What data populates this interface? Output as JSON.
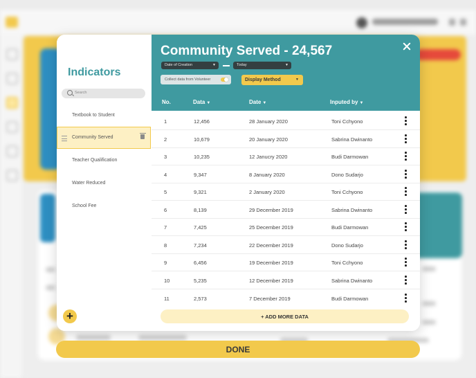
{
  "background": {
    "greeting": "Welcome, John Samuel"
  },
  "modal": {
    "title": "Community Served - 24,567",
    "indicators_title": "Indicators",
    "search_placeholder": "Search",
    "indicators": [
      "Textbook to Student",
      "Community Served",
      "Teacher Qualification",
      "Water Reduced",
      "School Fee"
    ],
    "active_indicator": "Community Served",
    "date_from": "Date of Creation",
    "date_to": "Today",
    "volunteer_toggle": "Collect data from Volunteer",
    "volunteer_enabled": true,
    "display_method": "Display Method",
    "columns": {
      "no": "No.",
      "data": "Data",
      "date": "Date",
      "inputed_by": "Inputed by"
    },
    "rows": [
      {
        "no": "1",
        "data": "12,456",
        "date": "28 January 2020",
        "by": "Toni Cchyono"
      },
      {
        "no": "2",
        "data": "10,679",
        "date": "20 January 2020",
        "by": "Sabrina Dwinanto"
      },
      {
        "no": "3",
        "data": "10,235",
        "date": "12 Janucry 2020",
        "by": "Budi Darmowan"
      },
      {
        "no": "4",
        "data": "9,347",
        "date": "8 January 2020",
        "by": "Dono Sudarjo"
      },
      {
        "no": "5",
        "data": "9,321",
        "date": "2 January 2020",
        "by": "Toni Cchyono"
      },
      {
        "no": "6",
        "data": "8,139",
        "date": "29 December 2019",
        "by": "Sabrina Dwinanto"
      },
      {
        "no": "7",
        "data": "7,425",
        "date": "25 December 2019",
        "by": "Budi Darmowan"
      },
      {
        "no": "8",
        "data": "7,234",
        "date": "22 December 2019",
        "by": "Dono Sudarjo"
      },
      {
        "no": "9",
        "data": "6,456",
        "date": "19 December 2019",
        "by": "Toni Cchyono"
      },
      {
        "no": "10",
        "data": "5,235",
        "date": "12 December 2019",
        "by": "Sabrina Dwinanto"
      },
      {
        "no": "11",
        "data": "2,573",
        "date": "7 December 2019",
        "by": "Budi Darmowan"
      }
    ],
    "add_more_label": "+ ADD MORE DATA",
    "done_label": "DONE"
  },
  "colors": {
    "teal": "#3f9aa0",
    "yellow": "#f2c94c",
    "pale_yellow": "#fdf0c4"
  }
}
